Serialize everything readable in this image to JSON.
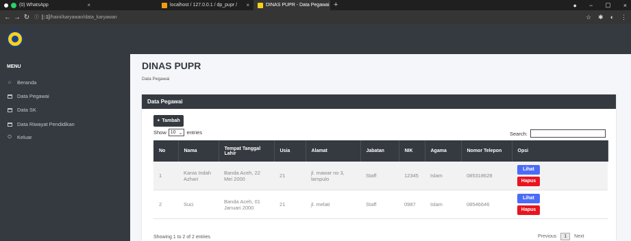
{
  "browser": {
    "tabs": [
      {
        "label": "(0) WhatsApp",
        "close": "×"
      },
      {
        "label": "localhost / 127.0.0.1 / dp_pupr / ",
        "close": "×"
      },
      {
        "label": "DINAS PUPR - Data Pegawai",
        "close": "×"
      }
    ],
    "new_tab": "+",
    "url_prefix": "ⓘ",
    "url_host": "[::1]",
    "url_path": "/haini/karyawan/data_karyawan",
    "colors": {
      "whatsapp": "#25d366",
      "pma": "#f39c12",
      "pupr": "#f4d21a"
    }
  },
  "sidebar": {
    "menu_title": "MENU",
    "items": [
      {
        "label": "Beranda",
        "icon": "home-icon"
      },
      {
        "label": "Data Pegawai",
        "icon": "table-icon"
      },
      {
        "label": "Data SK",
        "icon": "table-icon"
      },
      {
        "label": "Data Riwayat Pendidikan",
        "icon": "table-icon"
      },
      {
        "label": "Keluar",
        "icon": "power-icon"
      }
    ]
  },
  "page": {
    "title": "DINAS PUPR",
    "breadcrumb": "Data Pegawai"
  },
  "card": {
    "header": "Data Pegawai",
    "add_button": "Tambah",
    "show_prefix": "Show",
    "show_value": "10",
    "show_suffix": "entries",
    "search_label": "Search:",
    "info": "Showing 1 to 2 of 2 entries",
    "pagination": {
      "previous": "Previous",
      "current": "1",
      "next": "Next"
    }
  },
  "table": {
    "headers": [
      "No",
      "Nama",
      "Tempat Tanggal Lahir",
      "Usia",
      "Alamat",
      "Jabatan",
      "NIK",
      "Agama",
      "Nomor Telepon",
      "Opsi"
    ],
    "rows": [
      {
        "no": "1",
        "nama": "Kania Indah Azhari",
        "ttl": "Banda Aceh, 22 Mei 2000",
        "usia": "21",
        "alamat": "jl. mawar no 3, lampulo",
        "jabatan": "Staff",
        "nik": "12345",
        "agama": "Islam",
        "telepon": "085318628",
        "lihat": "Lihat",
        "hapus": "Hapus"
      },
      {
        "no": "2",
        "nama": "Suci",
        "ttl": "Banda Aceh, 01 Januari 2000",
        "usia": "21",
        "alamat": "jl. melati",
        "jabatan": "Staff",
        "nik": "0987",
        "agama": "Islam",
        "telepon": "08546646",
        "lihat": "Lihat",
        "hapus": "Hapus"
      }
    ]
  },
  "colors": {
    "dark": "#343a40",
    "primary": "#4a6cf7",
    "danger": "#e8151f"
  }
}
